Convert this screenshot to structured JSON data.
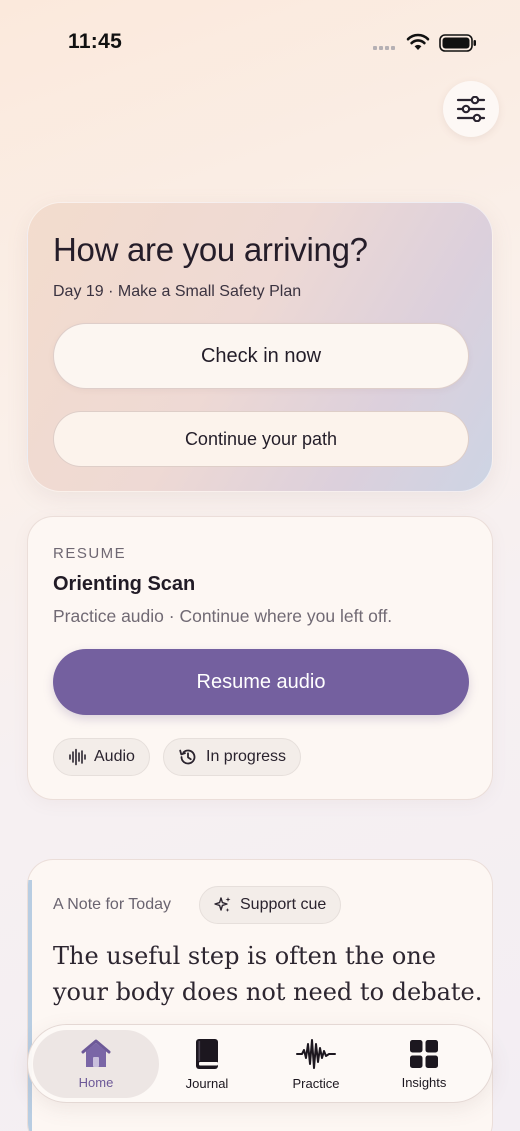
{
  "status_bar": {
    "time": "11:45"
  },
  "hero": {
    "title": "How are you arriving?",
    "subtitle": "Day 19 · Make a Small Safety Plan",
    "primary_button": "Check in now",
    "secondary_button": "Continue your path"
  },
  "resume": {
    "eyebrow": "RESUME",
    "title": "Orienting Scan",
    "description": "Practice audio · Continue where you left off.",
    "button": "Resume audio",
    "chips": [
      {
        "label": "Audio",
        "icon": "waveform-icon"
      },
      {
        "label": "In progress",
        "icon": "history-icon"
      }
    ]
  },
  "note": {
    "eyebrow": "A Note for Today",
    "chip": {
      "label": "Support cue",
      "icon": "sparkle-icon"
    },
    "quote": "The useful step is often the one your body does not need to debate."
  },
  "tab_bar": {
    "tabs": [
      {
        "label": "Home",
        "icon": "home-icon",
        "active": true
      },
      {
        "label": "Journal",
        "icon": "book-icon",
        "active": false
      },
      {
        "label": "Practice",
        "icon": "waveform-icon",
        "active": false
      },
      {
        "label": "Insights",
        "icon": "grid-icon",
        "active": false
      }
    ]
  },
  "colors": {
    "accent": "#74609f",
    "active_tab_text": "#6d5998",
    "note_accent": "#b8cde2"
  }
}
